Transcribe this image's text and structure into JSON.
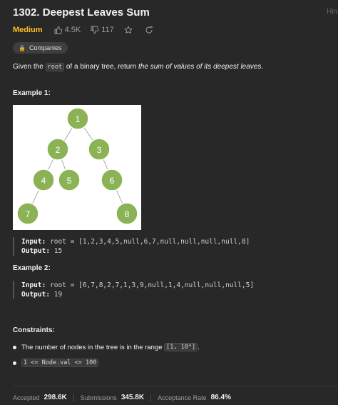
{
  "header_hint": "Hin",
  "problem": {
    "title": "1302. Deepest Leaves Sum",
    "difficulty": "Medium",
    "likes": "4.5K",
    "dislikes": "117",
    "companies_label": "Companies"
  },
  "description": {
    "pre": "Given the",
    "code": "root",
    "mid": "of a binary tree, return",
    "emph": "the sum of values of its deepest leaves",
    "end": "."
  },
  "examples": [
    {
      "heading": "Example 1:",
      "input_label": "Input:",
      "input": "root = [1,2,3,4,5,null,6,7,null,null,null,null,8]",
      "output_label": "Output:",
      "output": "15"
    },
    {
      "heading": "Example 2:",
      "input_label": "Input:",
      "input": "root = [6,7,8,2,7,1,3,9,null,1,4,null,null,null,5]",
      "output_label": "Output:",
      "output": "19"
    }
  ],
  "tree_nodes": [
    "1",
    "2",
    "3",
    "4",
    "5",
    "6",
    "7",
    "8"
  ],
  "constraints": {
    "heading": "Constraints:",
    "c1_text": "The number of nodes in the tree is in the range",
    "c1_code": "[1, 10⁴]",
    "c1_end": ".",
    "c2_code": "1 <= Node.val <= 100"
  },
  "stats": {
    "accepted_label": "Accepted",
    "accepted": "298.6K",
    "submissions_label": "Submissions",
    "submissions": "345.8K",
    "rate_label": "Acceptance Rate",
    "rate": "86.4%"
  },
  "colors": {
    "background": "#282828",
    "medium": "#ffc01e",
    "node": "#8bb356"
  }
}
